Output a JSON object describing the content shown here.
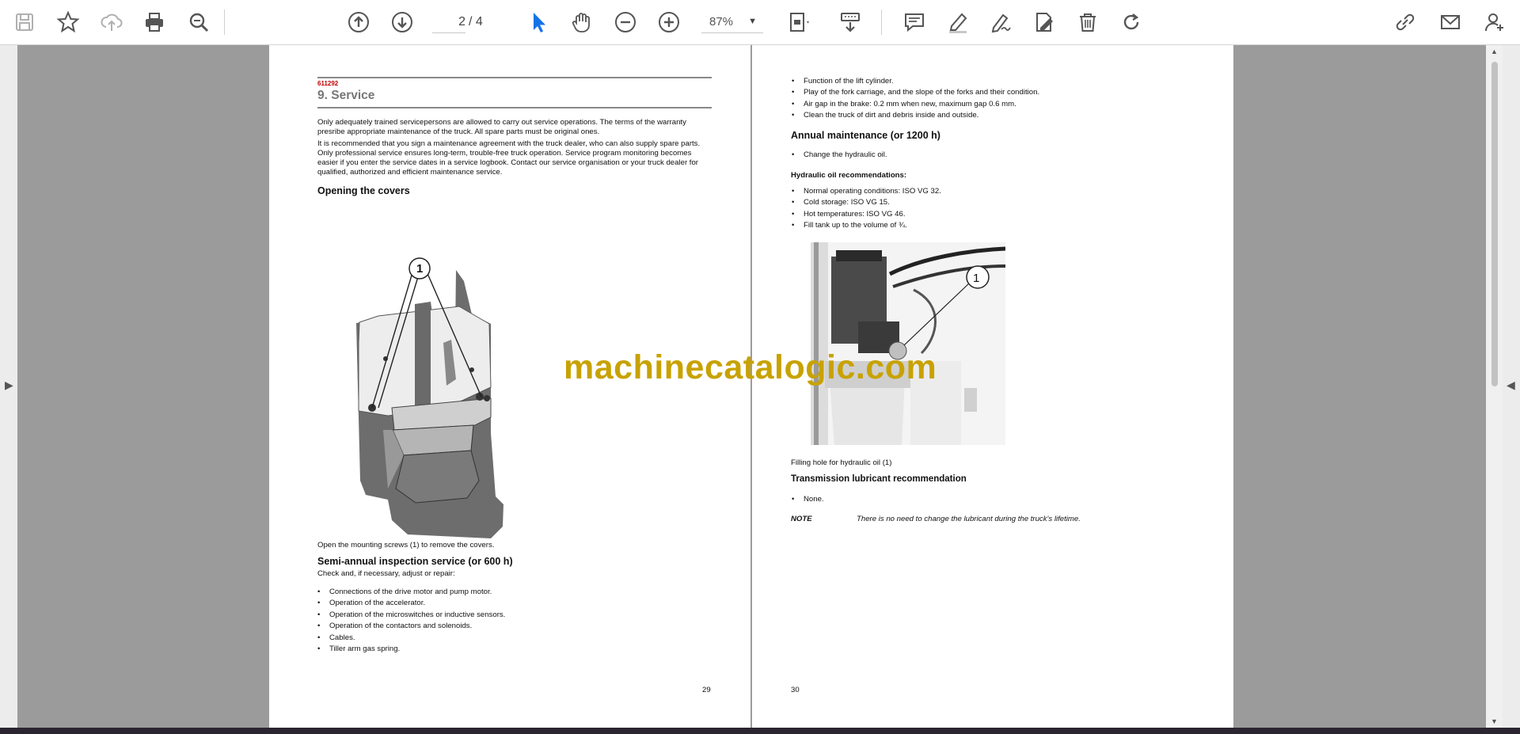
{
  "toolbar": {
    "page_current": "2",
    "page_total": "/ 4",
    "zoom": "87%"
  },
  "page_left": {
    "doc_code": "611292",
    "section_title": "9. Service",
    "intro_1": "Only adequately trained servicepersons are allowed to carry out service operations. The terms of the warranty presribe appropriate maintenance of the truck. All spare parts must be original ones.",
    "intro_2": "It is recommended that you sign a maintenance agreement with the truck dealer, who can also supply spare parts. Only professional service ensures long-term, trouble-free truck operation. Service program monitoring becomes easier if you enter the service dates in a service logbook. Contact our service organisation or your truck dealer for qualified, authorized and efficient maintenance service.",
    "heading_covers": "Opening the covers",
    "callout": "1",
    "caption_screws": "Open the mounting screws (1) to remove the covers.",
    "heading_semiannual": "Semi-annual inspection service (or 600 h)",
    "check_text": "Check and, if necessary, adjust or repair:",
    "checklist": [
      "Connections of the drive motor and pump motor.",
      "Operation of the accelerator.",
      "Operation of the microswitches or inductive sensors.",
      "Operation of the contactors and solenoids.",
      "Cables.",
      "Tiller arm gas spring."
    ],
    "page_number": "29"
  },
  "page_right": {
    "continued_list": [
      "Function of the lift cylinder.",
      "Play of the fork carriage, and the slope of the forks and their condition.",
      "Air gap in the brake: 0.2 mm when new, maximum gap 0.6 mm.",
      "Clean the truck of dirt and debris inside and outside."
    ],
    "heading_annual": "Annual maintenance (or 1200 h)",
    "annual_list": [
      "Change the hydraulic oil."
    ],
    "oil_heading": "Hydraulic oil recommendations:",
    "oil_list": [
      "Normal operating conditions: ISO VG 32.",
      "Cold storage: ISO VG 15.",
      "Hot temperatures: ISO VG 46.",
      "Fill tank up to the volume of ¾."
    ],
    "callout": "1",
    "caption_oil": "Filling hole for hydraulic oil (1)",
    "heading_transmission": "Transmission lubricant recommendation",
    "transmission_list": [
      "None."
    ],
    "note_label": "NOTE",
    "note_text": "There is no need to change the lubricant during the truck's lifetime.",
    "page_number": "30"
  },
  "watermark": "machinecatalogic.com"
}
